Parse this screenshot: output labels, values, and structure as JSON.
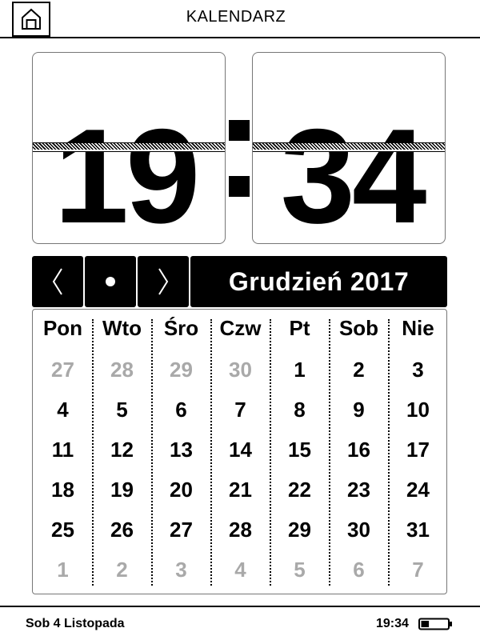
{
  "header": {
    "title": "KALENDARZ",
    "home_icon": "home-icon"
  },
  "clock": {
    "hours": "19",
    "minutes": "34"
  },
  "nav": {
    "prev_icon": "chevron-left-icon",
    "today_icon": "dot-icon",
    "next_icon": "chevron-right-icon",
    "month_title": "Grudzień 2017"
  },
  "calendar": {
    "weekdays": [
      "Pon",
      "Wto",
      "Śro",
      "Czw",
      "Pt",
      "Sob",
      "Nie"
    ],
    "weeks": [
      [
        {
          "d": "27",
          "other": true
        },
        {
          "d": "28",
          "other": true
        },
        {
          "d": "29",
          "other": true
        },
        {
          "d": "30",
          "other": true
        },
        {
          "d": "1",
          "other": false
        },
        {
          "d": "2",
          "other": false
        },
        {
          "d": "3",
          "other": false
        }
      ],
      [
        {
          "d": "4",
          "other": false
        },
        {
          "d": "5",
          "other": false
        },
        {
          "d": "6",
          "other": false
        },
        {
          "d": "7",
          "other": false
        },
        {
          "d": "8",
          "other": false
        },
        {
          "d": "9",
          "other": false
        },
        {
          "d": "10",
          "other": false
        }
      ],
      [
        {
          "d": "11",
          "other": false
        },
        {
          "d": "12",
          "other": false
        },
        {
          "d": "13",
          "other": false
        },
        {
          "d": "14",
          "other": false
        },
        {
          "d": "15",
          "other": false
        },
        {
          "d": "16",
          "other": false
        },
        {
          "d": "17",
          "other": false
        }
      ],
      [
        {
          "d": "18",
          "other": false
        },
        {
          "d": "19",
          "other": false
        },
        {
          "d": "20",
          "other": false
        },
        {
          "d": "21",
          "other": false
        },
        {
          "d": "22",
          "other": false
        },
        {
          "d": "23",
          "other": false
        },
        {
          "d": "24",
          "other": false
        }
      ],
      [
        {
          "d": "25",
          "other": false
        },
        {
          "d": "26",
          "other": false
        },
        {
          "d": "27",
          "other": false
        },
        {
          "d": "28",
          "other": false
        },
        {
          "d": "29",
          "other": false
        },
        {
          "d": "30",
          "other": false
        },
        {
          "d": "31",
          "other": false
        }
      ],
      [
        {
          "d": "1",
          "other": true
        },
        {
          "d": "2",
          "other": true
        },
        {
          "d": "3",
          "other": true
        },
        {
          "d": "4",
          "other": true
        },
        {
          "d": "5",
          "other": true
        },
        {
          "d": "6",
          "other": true
        },
        {
          "d": "7",
          "other": true
        }
      ]
    ],
    "muted_color": "#a9a9a9"
  },
  "status": {
    "date": "Sob 4 Listopada",
    "time": "19:34",
    "battery_icon": "battery-icon",
    "battery_level": 0.3
  }
}
